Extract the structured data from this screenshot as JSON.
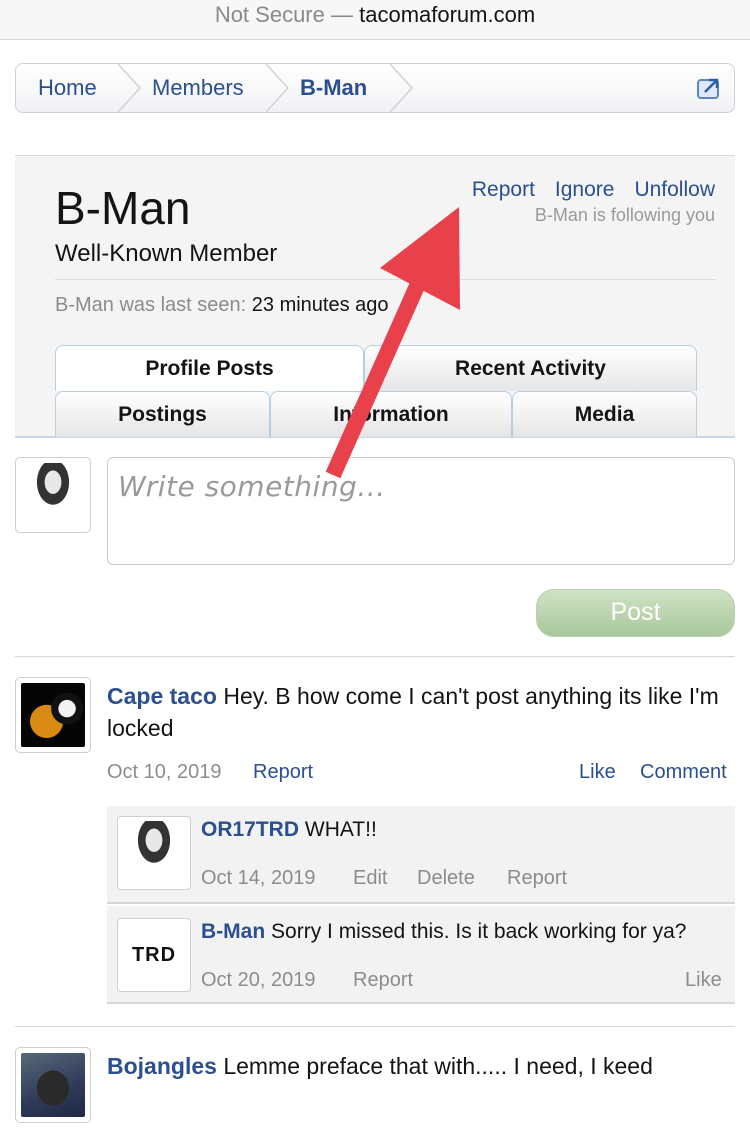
{
  "browser": {
    "security": "Not Secure",
    "separator": " — ",
    "domain": "tacomaforum.com"
  },
  "breadcrumb": {
    "items": [
      "Home",
      "Members",
      "B-Man"
    ]
  },
  "profile": {
    "name": "B-Man",
    "title": "Well-Known Member",
    "actions": {
      "report": "Report",
      "ignore": "Ignore",
      "unfollow": "Unfollow"
    },
    "following_note": "B-Man is following you",
    "last_seen_label": "B-Man was last seen:",
    "last_seen_value": "23 minutes ago",
    "tabs_row1": [
      "Profile Posts",
      "Recent Activity"
    ],
    "tabs_row2": [
      "Postings",
      "Information",
      "Media"
    ]
  },
  "composer": {
    "placeholder": "Write something...",
    "post_label": "Post"
  },
  "posts": [
    {
      "author": "Cape taco",
      "text": "Hey. B how come I can't post anything its like I'm locked",
      "date": "Oct 10, 2019",
      "actions": {
        "report": "Report",
        "like": "Like",
        "comment": "Comment"
      },
      "replies": [
        {
          "author": "OR17TRD",
          "text": "WHAT!!",
          "date": "Oct 14, 2019",
          "actions": {
            "edit": "Edit",
            "delete": "Delete",
            "report": "Report"
          }
        },
        {
          "author": "B-Man",
          "text": "Sorry I missed this. Is it back working for ya?",
          "date": "Oct 20, 2019",
          "actions": {
            "report": "Report",
            "like": "Like"
          },
          "avatar_text": "TRD"
        }
      ]
    },
    {
      "author": "Bojangles",
      "text": "Lemme preface that with..... I need, I keed"
    }
  ],
  "colors": {
    "link": "#2b4f8f",
    "annotation_arrow": "#e8414c",
    "post_button": "#a8c79b"
  }
}
